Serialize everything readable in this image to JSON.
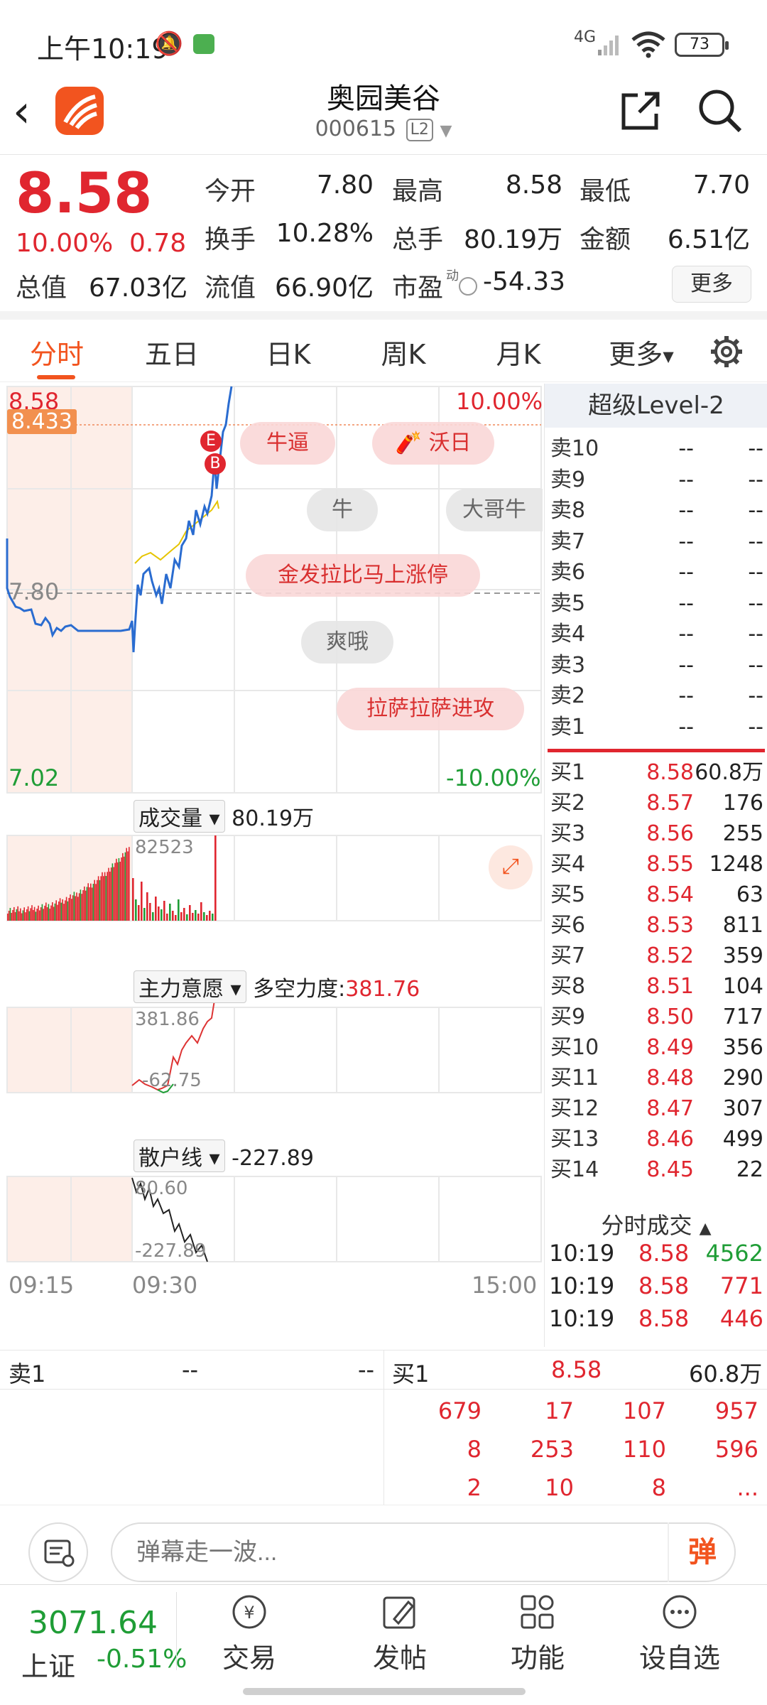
{
  "status_bar": {
    "time": "上午10:19",
    "network": "4G",
    "battery": "73"
  },
  "header": {
    "title": "奥园美谷",
    "code": "000615",
    "level_badge": "L2"
  },
  "quote": {
    "price": "8.58",
    "change_pct": "10.00%",
    "change": "0.78",
    "fields": [
      {
        "label": "今开",
        "value": "7.80",
        "color": "#222222"
      },
      {
        "label": "最高",
        "value": "8.58",
        "color": "#e0262f"
      },
      {
        "label": "最低",
        "value": "7.70",
        "color": "#1f9d36"
      },
      {
        "label": "换手",
        "value": "10.28%",
        "color": "#222222"
      },
      {
        "label": "总手",
        "value": "80.19万",
        "color": "#222222"
      },
      {
        "label": "金额",
        "value": "6.51亿",
        "color": "#222222"
      },
      {
        "label": "总值",
        "value": "67.03亿",
        "color": "#222222"
      },
      {
        "label": "流值",
        "value": "66.90亿",
        "color": "#222222"
      },
      {
        "label": "市盈",
        "value": "-54.33",
        "color": "#222222",
        "superscript": "动"
      }
    ],
    "more_label": "更多"
  },
  "tabs": [
    "分时",
    "五日",
    "日K",
    "周K",
    "月K",
    "更多"
  ],
  "chart": {
    "price_top": "8.58",
    "price_mark": "8.433",
    "price_open": "7.80",
    "price_bottom": "7.02",
    "pct_top": "10.00%",
    "pct_bottom": "-10.00%",
    "volume_label": "成交量",
    "volume_value": "80.19万",
    "volume_max": "82523",
    "force_label": "主力意愿",
    "force_sub": "多空力度:",
    "force_value": "381.76",
    "force_top": "381.86",
    "force_bottom": "-62.75",
    "retail_label": "散户线",
    "retail_value": "-227.89",
    "retail_top": "80.60",
    "retail_bottom": "-227.89",
    "time_start": "09:15",
    "time_mid": "09:30",
    "time_end": "15:00",
    "marker_e": "E",
    "marker_b": "B",
    "danmu": [
      "牛逼",
      "沃日",
      "牛",
      "大哥牛",
      "金发拉比马上涨停",
      "爽哦",
      "拉萨拉萨进攻"
    ],
    "colors": {
      "up": "#e0262f",
      "down": "#1f9d36",
      "price_line": "#2a6cd0",
      "avg_line": "#e6c400"
    }
  },
  "order_book": {
    "title": "超级Level-2",
    "sells": [
      {
        "name": "卖10",
        "price": "--",
        "vol": "--"
      },
      {
        "name": "卖9",
        "price": "--",
        "vol": "--"
      },
      {
        "name": "卖8",
        "price": "--",
        "vol": "--"
      },
      {
        "name": "卖7",
        "price": "--",
        "vol": "--"
      },
      {
        "name": "卖6",
        "price": "--",
        "vol": "--"
      },
      {
        "name": "卖5",
        "price": "--",
        "vol": "--"
      },
      {
        "name": "卖4",
        "price": "--",
        "vol": "--"
      },
      {
        "name": "卖3",
        "price": "--",
        "vol": "--"
      },
      {
        "name": "卖2",
        "price": "--",
        "vol": "--"
      },
      {
        "name": "卖1",
        "price": "--",
        "vol": "--"
      }
    ],
    "buys": [
      {
        "name": "买1",
        "price": "8.58",
        "vol": "60.8万"
      },
      {
        "name": "买2",
        "price": "8.57",
        "vol": "176"
      },
      {
        "name": "买3",
        "price": "8.56",
        "vol": "255"
      },
      {
        "name": "买4",
        "price": "8.55",
        "vol": "1248"
      },
      {
        "name": "买5",
        "price": "8.54",
        "vol": "63"
      },
      {
        "name": "买6",
        "price": "8.53",
        "vol": "811"
      },
      {
        "name": "买7",
        "price": "8.52",
        "vol": "359"
      },
      {
        "name": "买8",
        "price": "8.51",
        "vol": "104"
      },
      {
        "name": "买9",
        "price": "8.50",
        "vol": "717"
      },
      {
        "name": "买10",
        "price": "8.49",
        "vol": "356"
      },
      {
        "name": "买11",
        "price": "8.48",
        "vol": "290"
      },
      {
        "name": "买12",
        "price": "8.47",
        "vol": "307"
      },
      {
        "name": "买13",
        "price": "8.46",
        "vol": "499"
      },
      {
        "name": "买14",
        "price": "8.45",
        "vol": "22"
      }
    ],
    "trades_title": "分时成交",
    "trades": [
      {
        "time": "10:19",
        "price": "8.58",
        "vol": "4562"
      },
      {
        "time": "10:19",
        "price": "8.58",
        "vol": "771"
      },
      {
        "time": "10:19",
        "price": "8.58",
        "vol": "446"
      }
    ]
  },
  "level_row": {
    "sell_label": "卖1",
    "sell_price": "--",
    "sell_vol": "--",
    "buy_label": "买1",
    "buy_price": "8.58",
    "buy_vol": "60.8万",
    "queue": [
      [
        "679",
        "17",
        "107",
        "957"
      ],
      [
        "8",
        "253",
        "110",
        "596"
      ],
      [
        "2",
        "10",
        "8",
        "..."
      ]
    ]
  },
  "comment": {
    "placeholder": "弹幕走一波...",
    "button": "弹"
  },
  "bottom_nav": {
    "index_value": "3071.64",
    "index_name": "上证",
    "index_pct": "-0.51%",
    "items": [
      "交易",
      "发帖",
      "功能",
      "设自选"
    ]
  }
}
